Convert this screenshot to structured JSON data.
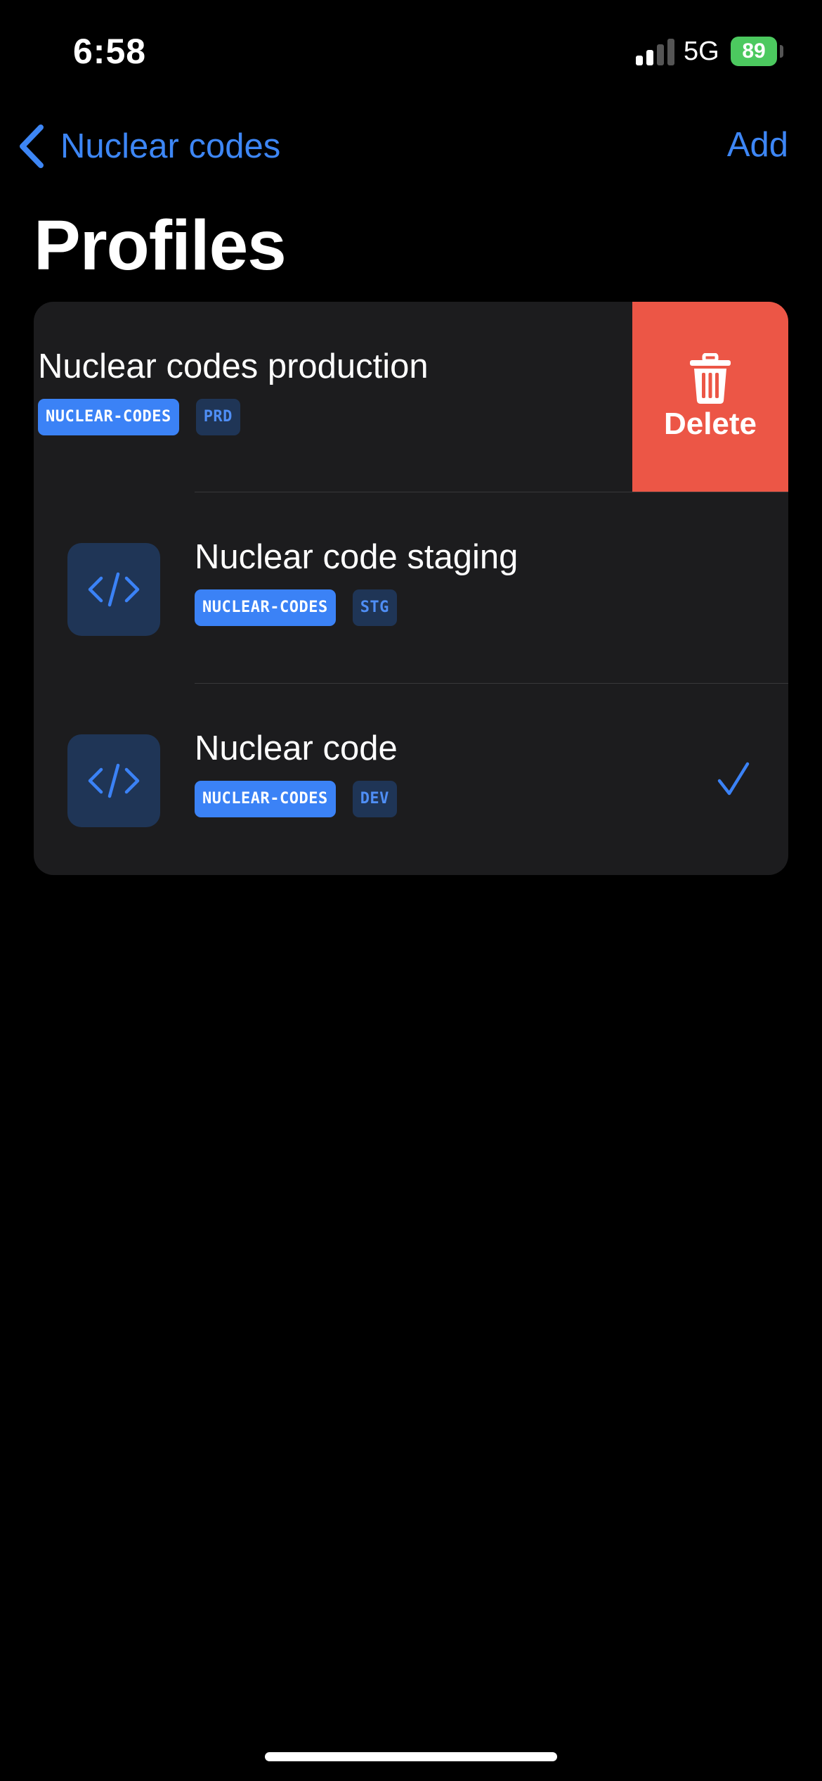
{
  "status_bar": {
    "time": "6:58",
    "network": "5G",
    "battery": "89",
    "battery_color": "#4cc95f"
  },
  "nav": {
    "back_label": "Nuclear codes",
    "add_label": "Add",
    "accent_color": "#3d86f5"
  },
  "page": {
    "title": "Profiles"
  },
  "profiles": [
    {
      "name": "Nuclear codes production",
      "icon": "code-icon",
      "tags": [
        "NUCLEAR-CODES",
        "PRD"
      ],
      "swiped": true,
      "selected": false
    },
    {
      "name": "Nuclear code staging",
      "icon": "code-icon",
      "tags": [
        "NUCLEAR-CODES",
        "STG"
      ],
      "swiped": false,
      "selected": false
    },
    {
      "name": "Nuclear code",
      "icon": "code-icon",
      "tags": [
        "NUCLEAR-CODES",
        "DEV"
      ],
      "swiped": false,
      "selected": true
    }
  ],
  "swipe_action": {
    "label": "Delete",
    "icon": "trash-icon",
    "color": "#ec5646"
  },
  "selection_icon": "checkmark-icon"
}
